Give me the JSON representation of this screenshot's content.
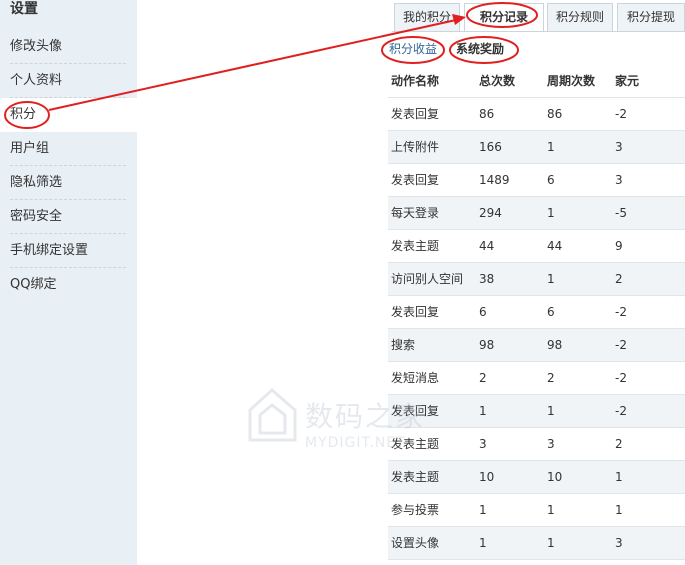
{
  "sidebar": {
    "title": "设置",
    "items": [
      {
        "label": "修改头像"
      },
      {
        "label": "个人资料"
      },
      {
        "label": "积分"
      },
      {
        "label": "用户组"
      },
      {
        "label": "隐私筛选"
      },
      {
        "label": "密码安全"
      },
      {
        "label": "手机绑定设置"
      },
      {
        "label": "QQ绑定"
      }
    ]
  },
  "tabs": [
    {
      "label": "我的积分"
    },
    {
      "label": "积分记录"
    },
    {
      "label": "积分规则"
    },
    {
      "label": "积分提现"
    }
  ],
  "subtabs": [
    {
      "label": "积分收益"
    },
    {
      "label": "系统奖励"
    }
  ],
  "table": {
    "headers": [
      "动作名称",
      "总次数",
      "周期次数",
      "家元"
    ],
    "rows": [
      [
        "发表回复",
        "86",
        "86",
        "-2"
      ],
      [
        "上传附件",
        "166",
        "1",
        "3"
      ],
      [
        "发表回复",
        "1489",
        "6",
        "3"
      ],
      [
        "每天登录",
        "294",
        "1",
        "-5"
      ],
      [
        "发表主题",
        "44",
        "44",
        "9"
      ],
      [
        "访问别人空间",
        "38",
        "1",
        "2"
      ],
      [
        "发表回复",
        "6",
        "6",
        "-2"
      ],
      [
        "搜索",
        "98",
        "98",
        "-2"
      ],
      [
        "发短消息",
        "2",
        "2",
        "-2"
      ],
      [
        "发表回复",
        "1",
        "1",
        "-2"
      ],
      [
        "发表主题",
        "3",
        "3",
        "2"
      ],
      [
        "发表主题",
        "10",
        "10",
        "1"
      ],
      [
        "参与投票",
        "1",
        "1",
        "1"
      ],
      [
        "设置头像",
        "1",
        "1",
        "3"
      ]
    ]
  },
  "watermark": {
    "text": "数码之家",
    "sub": "MYDIGIT.NET"
  },
  "colors": {
    "annotation": "#e02020",
    "sidebar_bg": "#e8eff5",
    "link": "#336699"
  }
}
